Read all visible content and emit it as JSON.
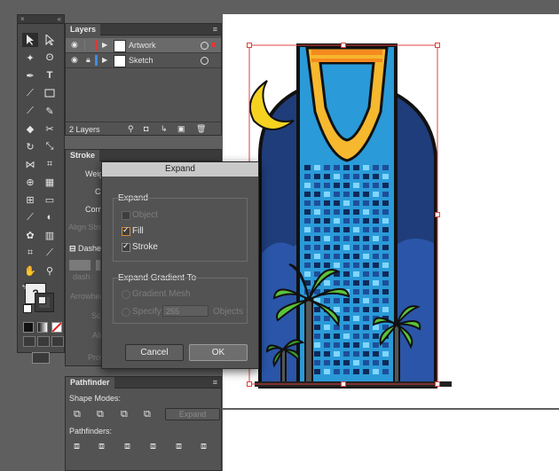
{
  "tools_panel": {
    "collapse": "«",
    "close": "×"
  },
  "layers": {
    "tab": "Layers",
    "menu": "≡",
    "items": [
      {
        "name": "Artwork",
        "color": "#e0373a"
      },
      {
        "name": "Sketch",
        "color": "#3b8ee8"
      }
    ],
    "footer_count": "2 Layers"
  },
  "stroke": {
    "tab": "Stroke",
    "labels": [
      "Weigh",
      "Ca",
      "Corne",
      "Align Strok",
      "Dashed",
      "dash",
      "Arrowhea",
      "Sca",
      "Alig",
      "Profi"
    ]
  },
  "pathfinder": {
    "tab": "Pathfinder",
    "shape_modes": "Shape Modes:",
    "expand_button": "Expand",
    "pathfinders": "Pathfinders:"
  },
  "dialog": {
    "title": "Expand",
    "expand_group": "Expand",
    "object_label": "Object",
    "fill_label": "Fill",
    "stroke_label": "Stroke",
    "gradient_group": "Expand Gradient To",
    "gradient_mesh_label": "Gradient Mesh",
    "specify_label": "Specify:",
    "specify_value": "255",
    "objects_label": "Objects",
    "cancel": "Cancel",
    "ok": "OK",
    "checked": {
      "object": false,
      "fill": true,
      "stroke": true
    }
  },
  "colors": {
    "sky": "#1f3d7a",
    "building": "#2a9ad8",
    "crest": "#f5b82e",
    "palm": "#5bc23a",
    "selection": "#e04040"
  }
}
